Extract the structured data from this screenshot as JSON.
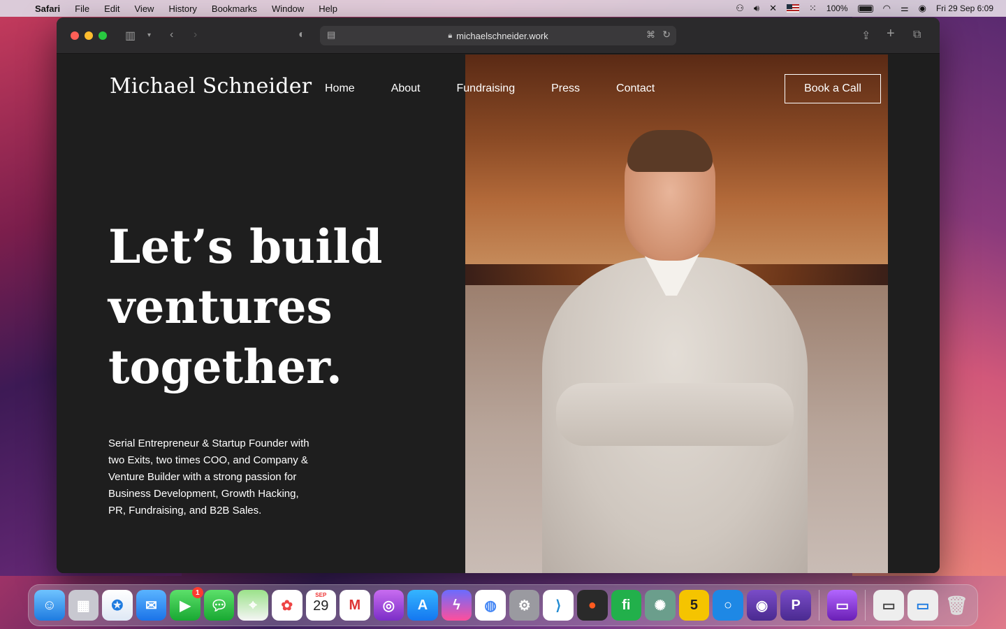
{
  "menubar": {
    "app_name": "Safari",
    "items": [
      "File",
      "Edit",
      "View",
      "History",
      "Bookmarks",
      "Window",
      "Help"
    ],
    "battery": "100%",
    "datetime": "Fri 29 Sep  6:09"
  },
  "browser": {
    "url": "michaelschneider.work"
  },
  "site": {
    "brand": "Michael Schneider",
    "nav": [
      "Home",
      "About",
      "Fundraising",
      "Press",
      "Contact"
    ],
    "cta": "Book a Call",
    "headline": "Let’s build ventures together.",
    "bio": "Serial Entrepreneur & Startup Founder with two Exits, two times COO, and Company & Venture Builder with a strong passion for Business Development, Growth Hacking, PR, Fundraising, and B2B Sales."
  },
  "dock": {
    "facetime_badge": "1",
    "calendar_month": "SEP",
    "calendar_day": "29"
  }
}
